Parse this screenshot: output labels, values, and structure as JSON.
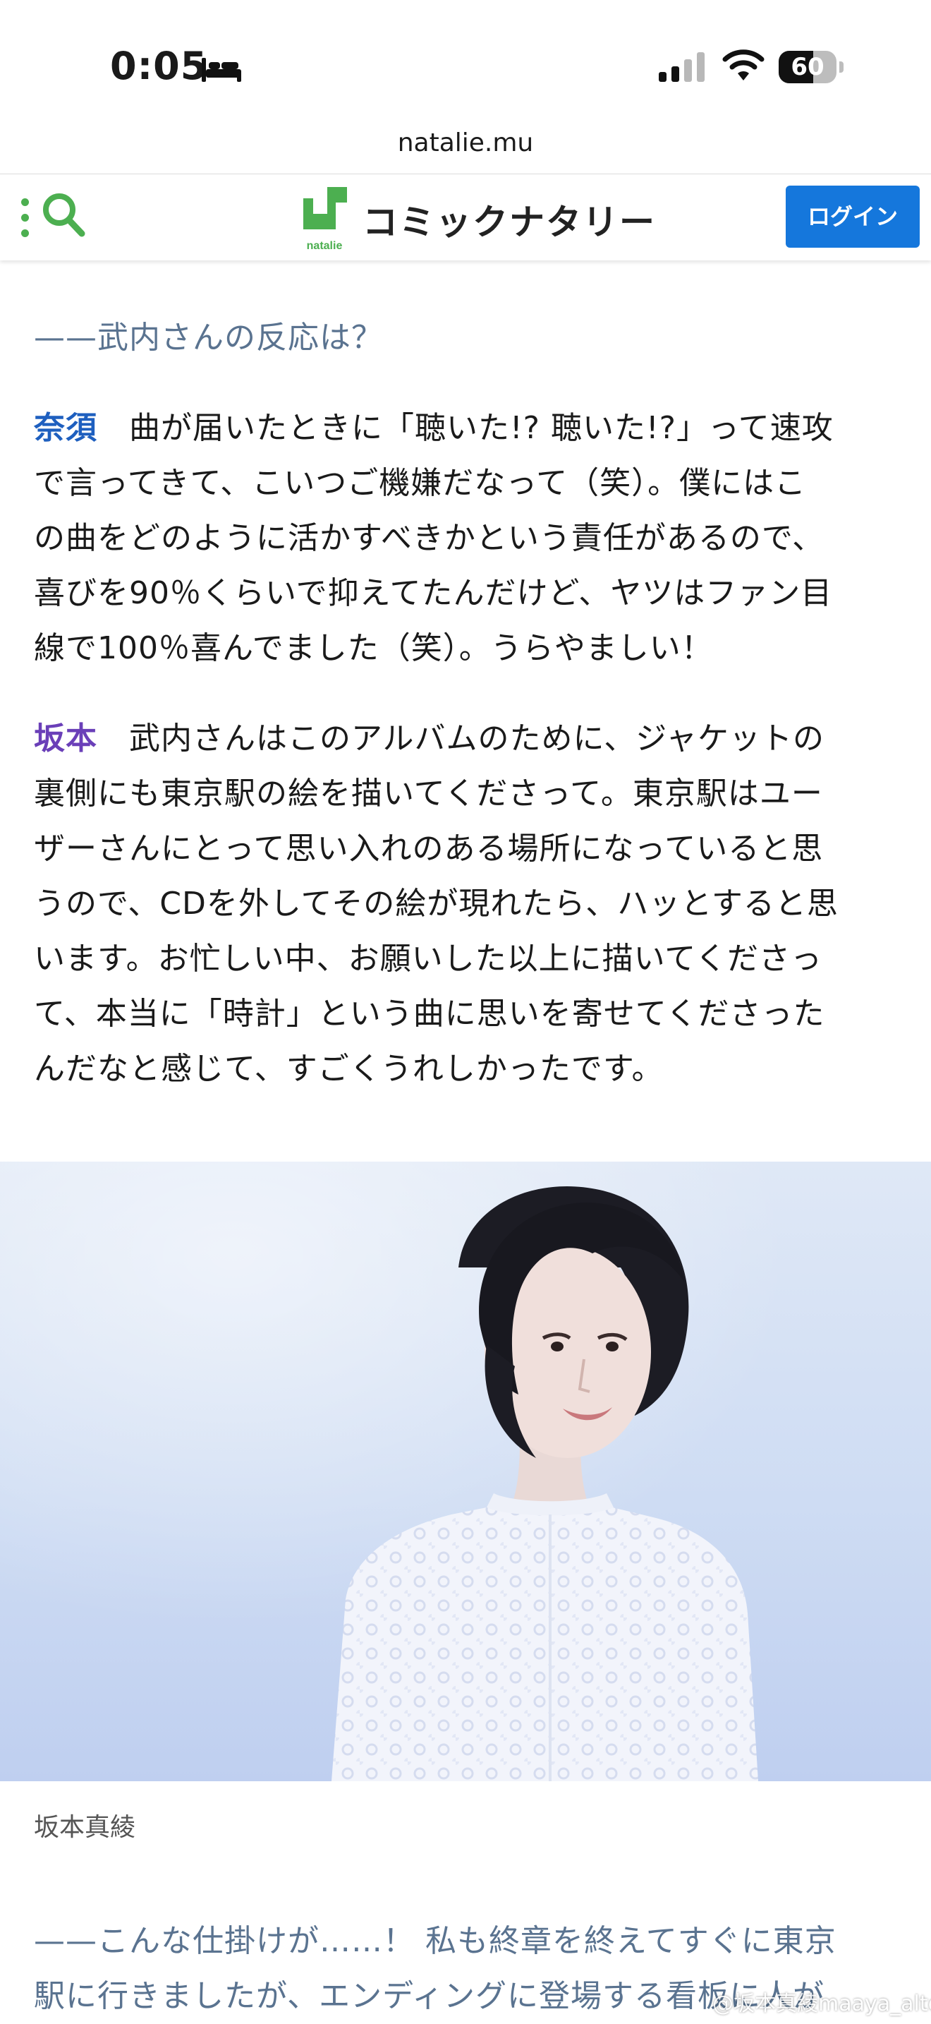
{
  "status_bar": {
    "time": "0:05",
    "battery_level": "60",
    "icons": [
      "bed-icon",
      "cellular-signal-icon",
      "wifi-icon",
      "battery-icon"
    ]
  },
  "browser": {
    "url": "natalie.mu"
  },
  "header": {
    "brand_name": "コミックナタリー",
    "logo_caption": "natalie",
    "login_label": "ログイン",
    "accent_color": "#4caf50",
    "login_color": "#1577dc"
  },
  "article": {
    "question_1": "——武内さんの反応は？",
    "answer_nasu": {
      "speaker": "奈須",
      "lines": [
        "曲が届いたときに「聴いた!? 聴いた!?」って速攻",
        "で言ってきて、こいつご機嫌だなって（笑）。僕にはこ",
        "の曲をどのように活かすべきかという責任があるので、",
        "喜びを90％くらいで抑えてたんだけど、ヤツはファン目",
        "線で100％喜んでました（笑）。うらやましい！"
      ]
    },
    "answer_sakamoto": {
      "speaker": "坂本",
      "lines": [
        "武内さんはこのアルバムのために、ジャケットの",
        "裏側にも東京駅の絵を描いてくださって。東京駅はユー",
        "ザーさんにとって思い入れのある場所になっていると思",
        "うので、CDを外してその絵が現れたら、ハッとすると思",
        "います。お忙しい中、お願いした以上に描いてくださっ",
        "て、本当に「時計」という曲に思いを寄せてくださった",
        "んだなと感じて、すごくうれしかったです。"
      ]
    },
    "photo_caption": "坂本真綾",
    "question_2_lines": [
      "——こんな仕掛けが……！ 私も終章を終えてすぐに東京",
      "駅に行きましたが、エンディングに登場する看板に人が"
    ],
    "speaker_colors": {
      "nasu": "#1e5fbf",
      "sakamoto": "#6a3fb8"
    }
  },
  "watermark": "@坂本真綾maaya_alter"
}
